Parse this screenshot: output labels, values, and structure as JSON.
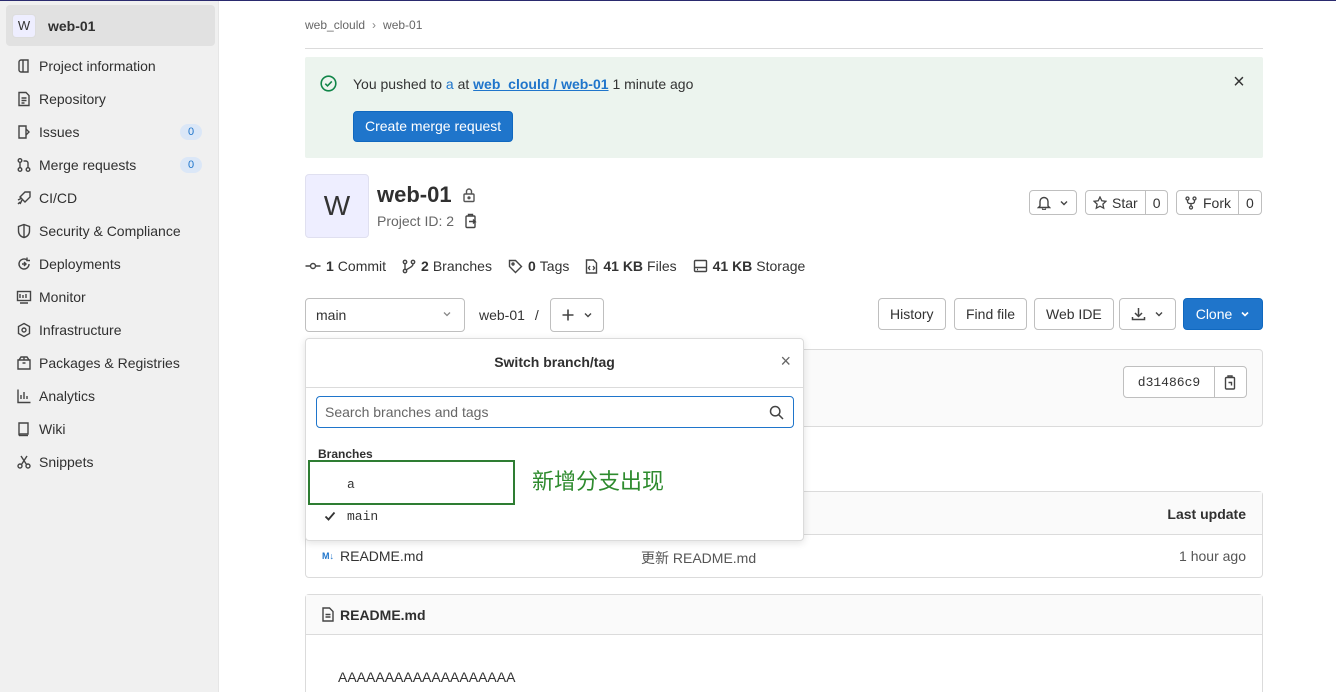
{
  "sidebar": {
    "project_initial": "W",
    "project_name": "web-01",
    "items": [
      {
        "label": "Project information",
        "icon": "info-icon"
      },
      {
        "label": "Repository",
        "icon": "document-icon"
      },
      {
        "label": "Issues",
        "icon": "issues-icon",
        "badge": "0"
      },
      {
        "label": "Merge requests",
        "icon": "merge-request-icon",
        "badge": "0"
      },
      {
        "label": "CI/CD",
        "icon": "rocket-icon"
      },
      {
        "label": "Security & Compliance",
        "icon": "shield-icon"
      },
      {
        "label": "Deployments",
        "icon": "deployments-icon"
      },
      {
        "label": "Monitor",
        "icon": "monitor-icon"
      },
      {
        "label": "Infrastructure",
        "icon": "infrastructure-icon"
      },
      {
        "label": "Packages & Registries",
        "icon": "package-icon"
      },
      {
        "label": "Analytics",
        "icon": "chart-icon"
      },
      {
        "label": "Wiki",
        "icon": "book-icon"
      },
      {
        "label": "Snippets",
        "icon": "snippet-icon"
      }
    ]
  },
  "breadcrumb": {
    "group": "web_clould",
    "project": "web-01"
  },
  "alert": {
    "prefix": "You pushed to",
    "branch": "a",
    "middle": "at",
    "project_link": "web_clould / web-01",
    "time": "1 minute ago",
    "button": "Create merge request"
  },
  "project": {
    "initial": "W",
    "title": "web-01",
    "id_text": "Project ID: 2"
  },
  "actions": {
    "star_label": "Star",
    "star_count": "0",
    "fork_label": "Fork",
    "fork_count": "0"
  },
  "stats": {
    "commits_n": "1",
    "commits_label": "Commit",
    "branches_n": "2",
    "branches_label": "Branches",
    "tags_n": "0",
    "tags_label": "Tags",
    "files_n": "41 KB",
    "files_label": "Files",
    "storage_n": "41 KB",
    "storage_label": "Storage"
  },
  "toolbar": {
    "branch": "main",
    "path": "web-01",
    "path_sep": "/",
    "history": "History",
    "find_file": "Find file",
    "web_ide": "Web IDE",
    "clone": "Clone"
  },
  "commit": {
    "sha": "d31486c9"
  },
  "files": {
    "header_last_update": "Last update",
    "rows": [
      {
        "icon": "M↓",
        "name": "README.md",
        "message": "更新 README.md",
        "time": "1 hour ago"
      }
    ]
  },
  "readme": {
    "title": "README.md",
    "content": "AAAAAAAAAAAAAAAAAAA"
  },
  "dropdown": {
    "title": "Switch branch/tag",
    "close": "×",
    "search_placeholder": "Search branches and tags",
    "section": "Branches",
    "branches": [
      "a",
      "main"
    ],
    "selected": "main"
  },
  "annotation": {
    "text": "新增分支出现",
    "color": "#2e8b2e"
  },
  "colors": {
    "primary": "#1f75cb",
    "alert_bg": "#ecf4ee",
    "sidebar_bg": "#f0f0f0"
  }
}
